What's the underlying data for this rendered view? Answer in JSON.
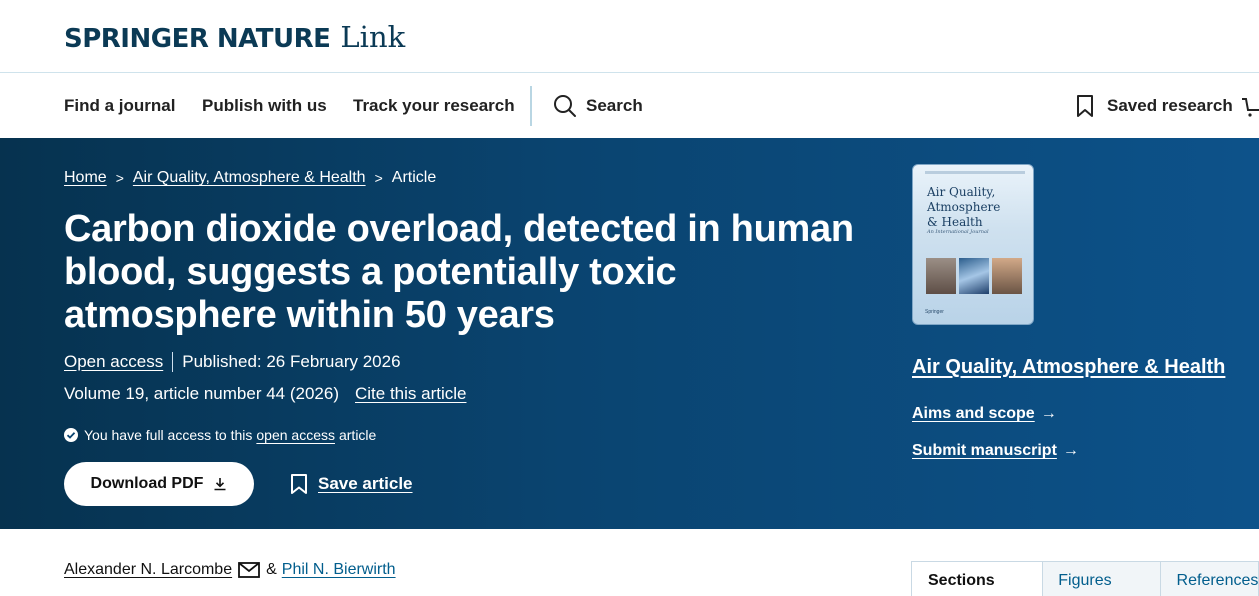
{
  "brand": {
    "main": "SPRINGER NATURE",
    "sub": "Link"
  },
  "nav": {
    "find_journal": "Find a journal",
    "publish": "Publish with us",
    "track": "Track your research",
    "search": "Search",
    "saved": "Saved research"
  },
  "breadcrumb": {
    "home": "Home",
    "journal": "Air Quality, Atmosphere & Health",
    "current": "Article"
  },
  "article": {
    "title": "Carbon dioxide overload, detected in human blood, suggests a potentially toxic atmosphere within 50 years",
    "open_access": "Open access",
    "published": "Published: 26 February 2026",
    "volume": "Volume 19, article number 44 (2026)",
    "cite": "Cite this article",
    "access_prefix": "You have full access to this",
    "access_link": "open access",
    "access_suffix": "article",
    "download": "Download PDF",
    "save": "Save article"
  },
  "journal": {
    "cover_title": "Air Quality,\nAtmosphere\n& Health",
    "cover_subtitle": "An International Journal",
    "cover_publisher": "Springer",
    "name": "Air Quality, Atmosphere & Health",
    "aims": "Aims and scope",
    "submit": "Submit manuscript"
  },
  "authors": {
    "author1": "Alexander N. Larcombe",
    "separator": "&",
    "author2": "Phil N. Bierwirth"
  },
  "tabs": {
    "sections": "Sections",
    "figures": "Figures",
    "references": "References"
  },
  "colors": {
    "hero_start": "#06324f",
    "hero_end": "#0d528a",
    "brand": "#0b3a55",
    "link_blue": "#025e8d"
  }
}
